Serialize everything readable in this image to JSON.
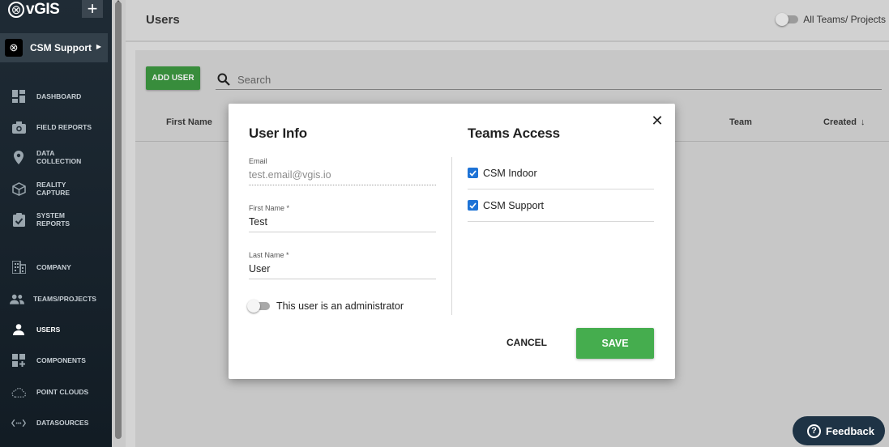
{
  "app": {
    "logo_text": "vGIS",
    "add_label": "+"
  },
  "team_selector": {
    "name": "CSM Support"
  },
  "sidebar": {
    "items": [
      {
        "label": "DASHBOARD",
        "icon": "dashboard-icon"
      },
      {
        "label": "FIELD REPORTS",
        "icon": "camera-icon"
      },
      {
        "label": "DATA COLLECTION",
        "icon": "map-pin-icon"
      },
      {
        "label": "REALITY CAPTURE",
        "icon": "cube-icon"
      },
      {
        "label": "SYSTEM REPORTS",
        "icon": "clipboard-check-icon"
      },
      {
        "label": "COMPANY",
        "icon": "building-icon"
      },
      {
        "label": "TEAMS/PROJECTS",
        "icon": "people-icon"
      },
      {
        "label": "USERS",
        "icon": "person-icon",
        "active": true
      },
      {
        "label": "COMPONENTS",
        "icon": "components-icon"
      },
      {
        "label": "POINT CLOUDS",
        "icon": "cloud-icon"
      },
      {
        "label": "DATASOURCES",
        "icon": "datasources-icon"
      }
    ]
  },
  "header": {
    "title": "Users",
    "toggle_label": "All Teams/ Projects"
  },
  "toolbar": {
    "add_user_label": "ADD USER",
    "search_placeholder": "Search"
  },
  "table": {
    "columns": [
      "First Name",
      "Team",
      "Created"
    ]
  },
  "modal": {
    "user_info_title": "User Info",
    "teams_access_title": "Teams Access",
    "email_label": "Email",
    "email_value": "test.email@vgis.io",
    "first_name_label": "First Name *",
    "first_name_value": "Test",
    "last_name_label": "Last Name *",
    "last_name_value": "User",
    "admin_label": "This user is an administrator",
    "teams": [
      {
        "name": "CSM Indoor",
        "checked": true
      },
      {
        "name": "CSM Support",
        "checked": true
      }
    ],
    "cancel_label": "CANCEL",
    "save_label": "SAVE"
  },
  "feedback": {
    "label": "Feedback"
  },
  "colors": {
    "accent_green": "#45ad4e",
    "checkbox_blue": "#1e73d6",
    "sidebar_bg": "#1f2b35"
  }
}
